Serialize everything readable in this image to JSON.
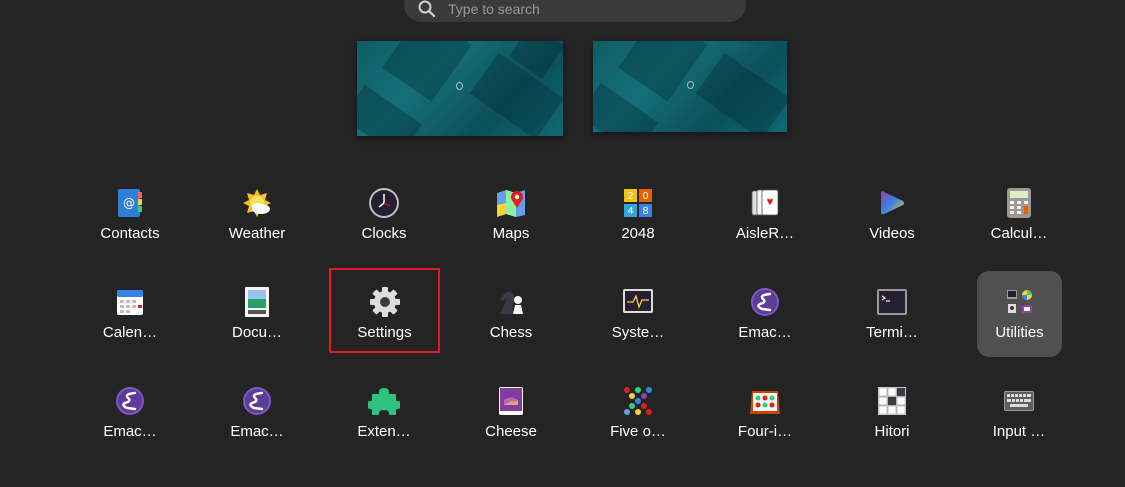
{
  "search": {
    "placeholder": "Type to search"
  },
  "workspaces": [
    "workspace-1",
    "workspace-2"
  ],
  "apps": {
    "contacts": "Contacts",
    "weather": "Weather",
    "clocks": "Clocks",
    "maps": "Maps",
    "game2048": "2048",
    "aislerriot": "AisleR…",
    "videos": "Videos",
    "calculator": "Calcul…",
    "calendar": "Calen…",
    "documents": "Docu…",
    "settings": "Settings",
    "chess": "Chess",
    "system_monitor": "Syste…",
    "emacs1": "Emac…",
    "terminal": "Termi…",
    "utilities": "Utilities",
    "emacs2": "Emac…",
    "emacs3": "Emac…",
    "extensions": "Exten…",
    "cheese": "Cheese",
    "five_or_more": "Five o…",
    "four_in_a_row": "Four-i…",
    "hitori": "Hitori",
    "input_method": "Input …"
  },
  "highlight_color": "#e01b24",
  "selected_color": "#505050"
}
